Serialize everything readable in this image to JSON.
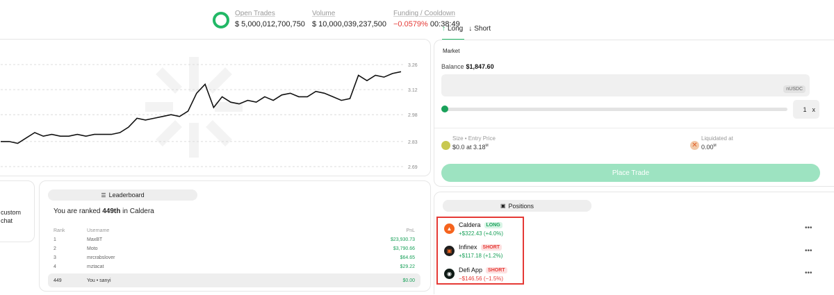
{
  "stats": {
    "open_trades_label": "Open Trades",
    "open_trades_value": "$ 5,000,012,700,750",
    "volume_label": "Volume",
    "volume_value": "$ 10,000,039,237,500",
    "funding_label": "Funding / Cooldown",
    "funding_value": "−0.0579%",
    "cooldown_value": "00:38:49"
  },
  "chart_data": {
    "type": "line",
    "yticks": [
      "3.26",
      "3.12",
      "2.98",
      "2.83",
      "2.69"
    ],
    "ylim": [
      2.69,
      3.26
    ],
    "grid": true,
    "series": [
      {
        "values": [
          2.83,
          2.83,
          2.82,
          2.85,
          2.88,
          2.86,
          2.87,
          2.86,
          2.86,
          2.87,
          2.86,
          2.87,
          2.87,
          2.87,
          2.88,
          2.91,
          2.96,
          2.95,
          2.96,
          2.97,
          2.98,
          2.97,
          3.0,
          3.1,
          3.15,
          3.02,
          3.08,
          3.05,
          3.04,
          3.06,
          3.05,
          3.08,
          3.06,
          3.09,
          3.1,
          3.08,
          3.08,
          3.11,
          3.1,
          3.08,
          3.06,
          3.07,
          3.2,
          3.17,
          3.2,
          3.19,
          3.21,
          3.22
        ]
      }
    ]
  },
  "left_card": {
    "line1": "custom",
    "line2": "chat"
  },
  "leaderboard": {
    "title": "Leaderboard",
    "rank_prefix": "You are ranked",
    "rank_value": "449th",
    "rank_suffix": "in Caldera",
    "headers": {
      "rank": "Rank",
      "username": "Username",
      "pnl": "PnL"
    },
    "rows": [
      {
        "rank": "1",
        "username": "MaxBT",
        "pnl": "$23,930.73"
      },
      {
        "rank": "2",
        "username": "Moto",
        "pnl": "$3,790.66"
      },
      {
        "rank": "3",
        "username": "mrcrabslover",
        "pnl": "$64.65"
      },
      {
        "rank": "4",
        "username": "mztacat",
        "pnl": "$29.22"
      }
    ],
    "you": {
      "rank": "449",
      "username": "You • sanyi",
      "pnl": "$0.00"
    }
  },
  "trade": {
    "tab_long": "Long",
    "tab_short": "Short",
    "market_label": "Market",
    "balance_label": "Balance",
    "balance_value": "$1,847.60",
    "unit": "nUSDC",
    "leverage_value": "1",
    "leverage_unit": "x",
    "size_label": "Size • Entry Price",
    "size_value": "$0.0 at 3.18",
    "size_sup": "M",
    "liq_label": "Liquidated at",
    "liq_value": "0.00",
    "liq_sup": "M",
    "place_label": "Place Trade",
    "slider_fraction": 0
  },
  "positions": {
    "title": "Positions",
    "items": [
      {
        "name": "Caldera",
        "side": "LONG",
        "pnl": "+$322.43 (+4.0%)",
        "logo_color": "#f5641e"
      },
      {
        "name": "Infinex",
        "side": "SHORT",
        "pnl": "+$117.18 (+1.2%)",
        "logo_color": "#1e1e1e"
      },
      {
        "name": "Defi App",
        "side": "SHORT",
        "pnl": "−$146.56 (−1.5%)",
        "logo_color": "#0f1c17"
      }
    ],
    "menu_glyph": "•••"
  },
  "colors": {
    "accent": "#22b866",
    "negative": "#e53935",
    "highlight": "#e53935"
  }
}
